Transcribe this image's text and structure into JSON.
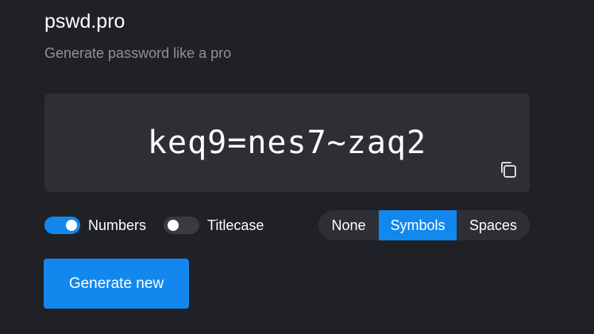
{
  "header": {
    "title": "pswd.pro",
    "subtitle": "Generate password like a pro"
  },
  "password": {
    "value": "keq9=nes7~zaq2",
    "copy_icon": "copy-icon"
  },
  "options": {
    "numbers": {
      "label": "Numbers",
      "enabled": true
    },
    "titlecase": {
      "label": "Titlecase",
      "enabled": false
    },
    "separator": {
      "items": [
        "None",
        "Symbols",
        "Spaces"
      ],
      "selected": "Symbols"
    }
  },
  "actions": {
    "generate_label": "Generate new"
  },
  "colors": {
    "background": "#202126",
    "panel": "#2e2f35",
    "accent": "#1288ee",
    "muted_text": "#8f9198"
  }
}
